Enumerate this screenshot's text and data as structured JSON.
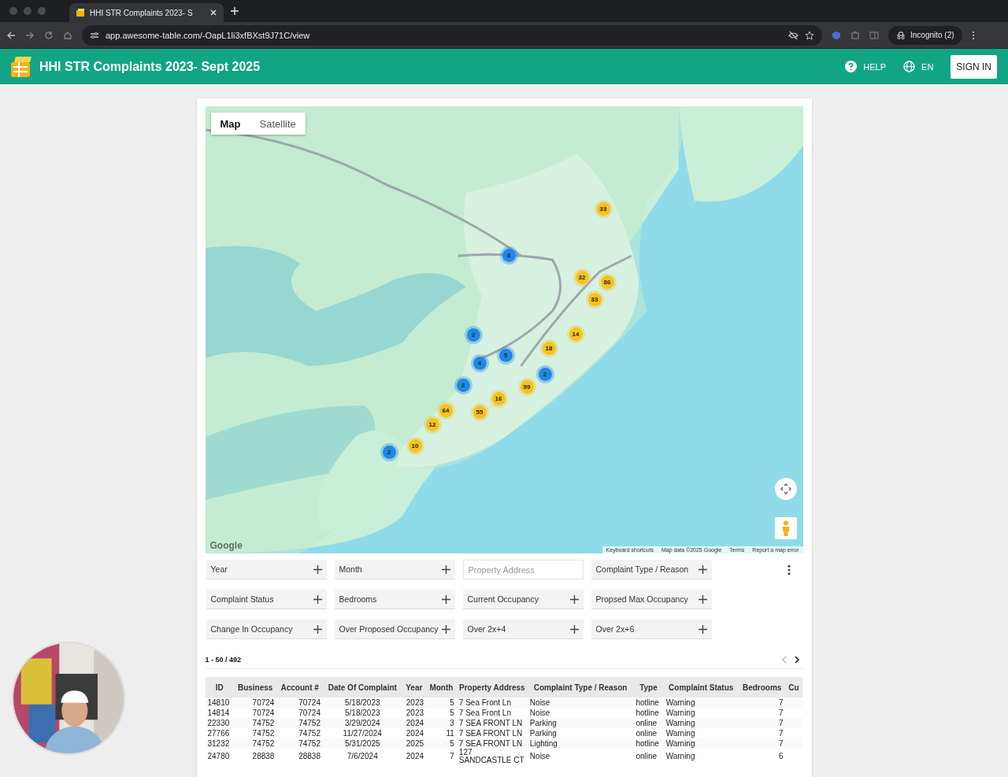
{
  "browser": {
    "tab_title": "HHI STR Complaints 2023- S",
    "url": "app.awesome-table.com/-OapL1li3xfBXst9J71C/view",
    "profile": "Incognito (2)"
  },
  "app_bar": {
    "title": "HHI STR Complaints 2023- Sept 2025",
    "help": "HELP",
    "language": "EN",
    "sign_in": "SIGN IN"
  },
  "map": {
    "view_tabs": [
      {
        "label": "Map",
        "selected": true
      },
      {
        "label": "Satellite",
        "selected": false
      }
    ],
    "clusters": [
      {
        "count": "33",
        "color": "#f6c21b"
      },
      {
        "count": "3",
        "color": "#1e88e5"
      },
      {
        "count": "32",
        "color": "#f6c21b"
      },
      {
        "count": "86",
        "color": "#f6c21b"
      },
      {
        "count": "33",
        "color": "#f6c21b"
      },
      {
        "count": "2",
        "color": "#1e88e5"
      },
      {
        "count": "14",
        "color": "#f6c21b"
      },
      {
        "count": "18",
        "color": "#f6c21b"
      },
      {
        "count": "5",
        "color": "#1e88e5"
      },
      {
        "count": "4",
        "color": "#1e88e5"
      },
      {
        "count": "2",
        "color": "#1e88e5"
      },
      {
        "count": "2",
        "color": "#1e88e5"
      },
      {
        "count": "99",
        "color": "#f6c21b"
      },
      {
        "count": "16",
        "color": "#f6c21b"
      },
      {
        "count": "64",
        "color": "#f6c21b"
      },
      {
        "count": "55",
        "color": "#f6c21b"
      },
      {
        "count": "12",
        "color": "#f6c21b"
      },
      {
        "count": "10",
        "color": "#f6c21b"
      },
      {
        "count": "2",
        "color": "#1e88e5"
      }
    ],
    "logo": "Google",
    "footer_links": [
      "Keyboard shortcuts",
      "Map data ©2025 Google",
      "Terms",
      "Report a map error"
    ]
  },
  "filters": [
    {
      "kind": "dropdown",
      "label": "Year"
    },
    {
      "kind": "dropdown",
      "label": "Month"
    },
    {
      "kind": "text",
      "placeholder": "Property Address"
    },
    {
      "kind": "dropdown",
      "label": "Complaint Type / Reason"
    },
    {
      "kind": "dropdown",
      "label": "Complaint Status"
    },
    {
      "kind": "dropdown",
      "label": "Bedrooms"
    },
    {
      "kind": "dropdown",
      "label": "Current Occupancy"
    },
    {
      "kind": "dropdown",
      "label": "Propsed Max Occupancy"
    },
    {
      "kind": "dropdown",
      "label": "Change In Occupancy"
    },
    {
      "kind": "dropdown",
      "label": "Over Proposed Occupancy"
    },
    {
      "kind": "dropdown",
      "label": "Over 2x+4"
    },
    {
      "kind": "dropdown",
      "label": "Over 2x+6"
    }
  ],
  "pagination": {
    "range": "1 - 50 / 492",
    "buttons": [
      {
        "kind": "prev",
        "disabled": true
      },
      {
        "kind": "next",
        "disabled": false
      }
    ]
  },
  "table": {
    "columns": [
      "ID",
      "Business",
      "Account #",
      "Date Of Complaint",
      "Year",
      "Month",
      "Property Address",
      "Complaint Type / Reason",
      "Type",
      "Complaint Status",
      "Bedrooms",
      "Cu"
    ],
    "rows": [
      [
        "14810",
        "70724",
        "70724",
        "5/18/2023",
        "2023",
        "5",
        "7 Sea Front Ln",
        "Noise",
        "hotline",
        "Warning",
        "7"
      ],
      [
        "14814",
        "70724",
        "70724",
        "5/18/2023",
        "2023",
        "5",
        "7 Sea Front Ln",
        "Noise",
        "hotline",
        "Warning",
        "7"
      ],
      [
        "22330",
        "74752",
        "74752",
        "3/29/2024",
        "2024",
        "3",
        "7 SEA FRONT LN",
        "Parking",
        "online",
        "Warning",
        "7"
      ],
      [
        "27766",
        "74752",
        "74752",
        "11/27/2024",
        "2024",
        "11",
        "7 SEA FRONT LN",
        "Parking",
        "online",
        "Warning",
        "7"
      ],
      [
        "31232",
        "74752",
        "74752",
        "5/31/2025",
        "2025",
        "5",
        "7 SEA FRONT LN",
        "Lighting",
        "hotline",
        "Warning",
        "7"
      ],
      [
        "24780",
        "28838",
        "28838",
        "7/6/2024",
        "2024",
        "7",
        "127 SANDCASTLE CT",
        "Noise",
        "online",
        "Warning",
        "6"
      ]
    ]
  }
}
